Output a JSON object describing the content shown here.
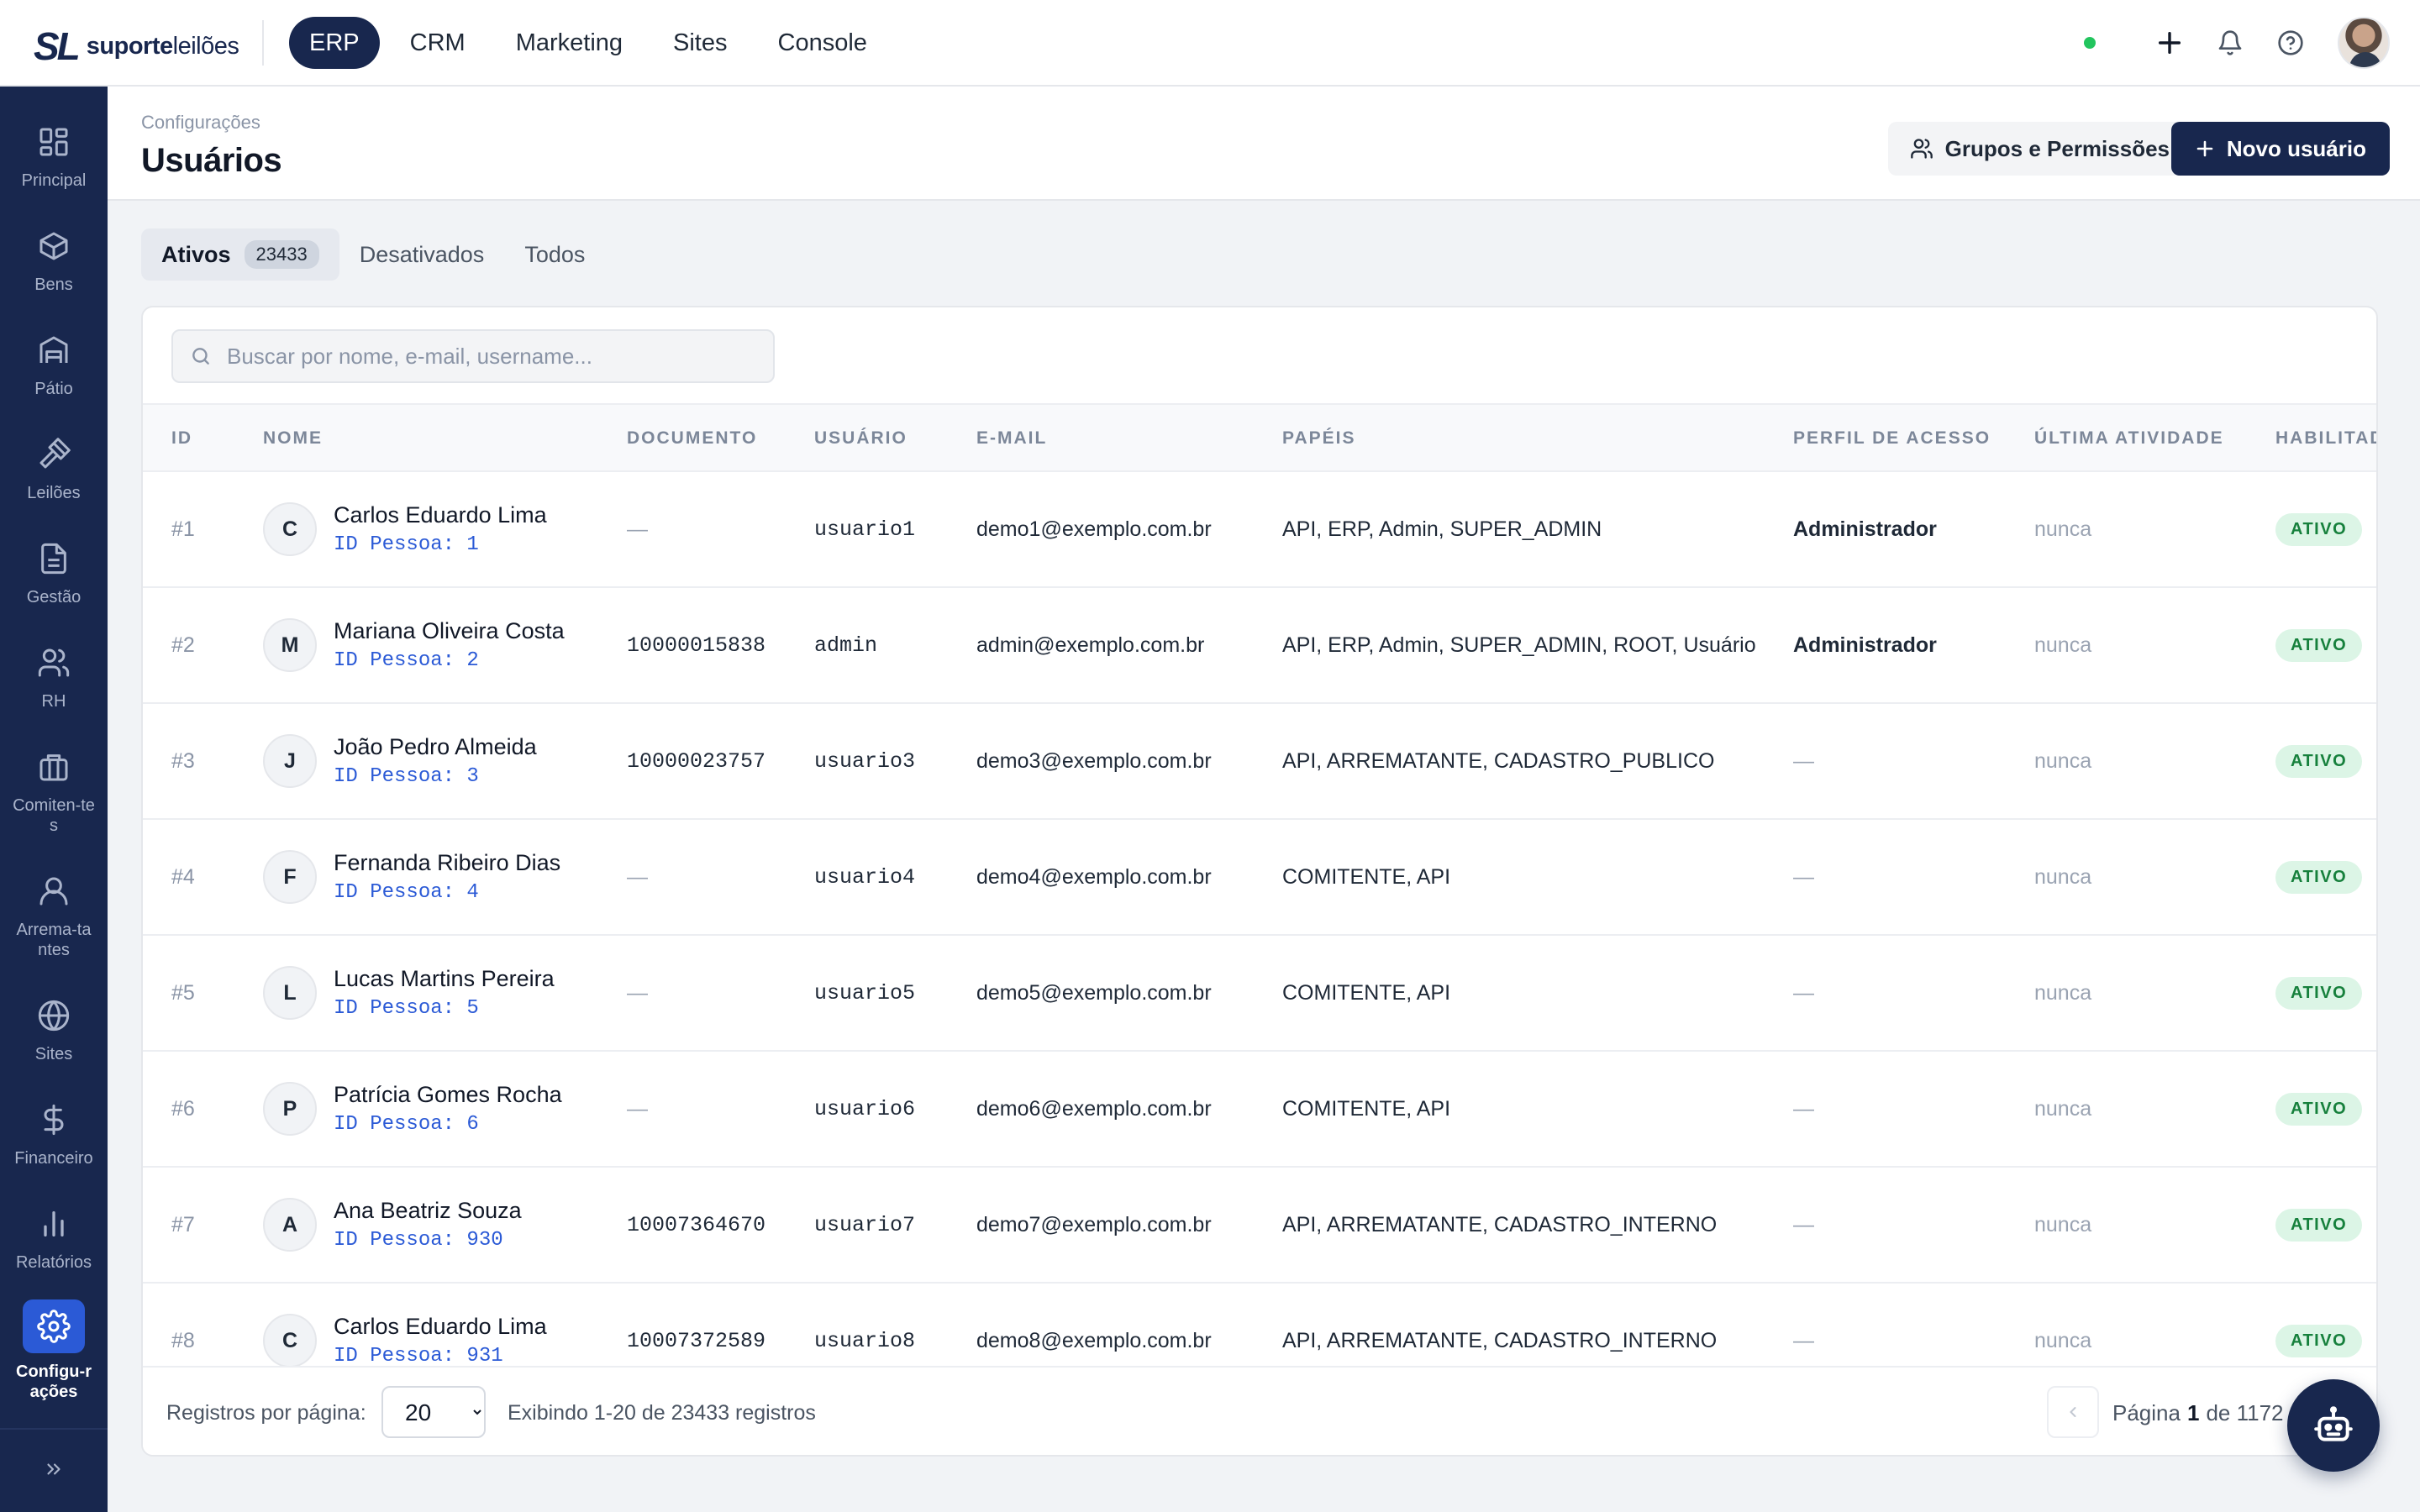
{
  "brand": {
    "mark": "SL",
    "name_bold": "suporte",
    "name_light": "leilões"
  },
  "topnav": [
    "ERP",
    "CRM",
    "Marketing",
    "Sites",
    "Console"
  ],
  "sidebar": {
    "items": [
      {
        "label": "Principal",
        "icon": "grid-icon"
      },
      {
        "label": "Bens",
        "icon": "box-icon"
      },
      {
        "label": "Pátio",
        "icon": "warehouse-icon"
      },
      {
        "label": "Leilões",
        "icon": "gavel-icon"
      },
      {
        "label": "Gestão",
        "icon": "document-icon"
      },
      {
        "label": "RH",
        "icon": "users-icon"
      },
      {
        "label": "Comiten-tes",
        "icon": "briefcase-icon"
      },
      {
        "label": "Arrema-tantes",
        "icon": "user-icon"
      },
      {
        "label": "Sites",
        "icon": "globe-icon"
      },
      {
        "label": "Financeiro",
        "icon": "dollar-icon"
      },
      {
        "label": "Relatórios",
        "icon": "bar-chart-icon"
      },
      {
        "label": "Configu-rações",
        "icon": "gear-icon"
      }
    ]
  },
  "header": {
    "breadcrumb": "Configurações",
    "title": "Usuários",
    "groups_button": "Grupos e Permissões",
    "new_button": "Novo usuário"
  },
  "tabs": {
    "active": "Ativos",
    "active_count": "23433",
    "disabled": "Desativados",
    "all": "Todos"
  },
  "search": {
    "placeholder": "Buscar por nome, e-mail, username..."
  },
  "table": {
    "columns": [
      "ID",
      "NOME",
      "DOCUMENTO",
      "USUÁRIO",
      "E-MAIL",
      "PAPÉIS",
      "PERFIL DE ACESSO",
      "ÚLTIMA ATIVIDADE",
      "HABILITAD"
    ],
    "rows": [
      {
        "id": "#1",
        "initial": "C",
        "name": "Carlos Eduardo Lima",
        "person": "ID Pessoa: 1",
        "document": "—",
        "username": "usuario1",
        "email": "demo1@exemplo.com.br",
        "roles": "API, ERP, Admin, SUPER_ADMIN",
        "profile": "Administrador",
        "last": "nunca",
        "status": "ATIVO"
      },
      {
        "id": "#2",
        "initial": "M",
        "name": "Mariana Oliveira Costa",
        "person": "ID Pessoa: 2",
        "document": "10000015838",
        "username": "admin",
        "email": "admin@exemplo.com.br",
        "roles": "API, ERP, Admin, SUPER_ADMIN, ROOT, Usuário",
        "profile": "Administrador",
        "last": "nunca",
        "status": "ATIVO"
      },
      {
        "id": "#3",
        "initial": "J",
        "name": "João Pedro Almeida",
        "person": "ID Pessoa: 3",
        "document": "10000023757",
        "username": "usuario3",
        "email": "demo3@exemplo.com.br",
        "roles": "API, ARREMATANTE, CADASTRO_PUBLICO",
        "profile": "—",
        "last": "nunca",
        "status": "ATIVO"
      },
      {
        "id": "#4",
        "initial": "F",
        "name": "Fernanda Ribeiro Dias",
        "person": "ID Pessoa: 4",
        "document": "—",
        "username": "usuario4",
        "email": "demo4@exemplo.com.br",
        "roles": "COMITENTE, API",
        "profile": "—",
        "last": "nunca",
        "status": "ATIVO"
      },
      {
        "id": "#5",
        "initial": "L",
        "name": "Lucas Martins Pereira",
        "person": "ID Pessoa: 5",
        "document": "—",
        "username": "usuario5",
        "email": "demo5@exemplo.com.br",
        "roles": "COMITENTE, API",
        "profile": "—",
        "last": "nunca",
        "status": "ATIVO"
      },
      {
        "id": "#6",
        "initial": "P",
        "name": "Patrícia Gomes Rocha",
        "person": "ID Pessoa: 6",
        "document": "—",
        "username": "usuario6",
        "email": "demo6@exemplo.com.br",
        "roles": "COMITENTE, API",
        "profile": "—",
        "last": "nunca",
        "status": "ATIVO"
      },
      {
        "id": "#7",
        "initial": "A",
        "name": "Ana Beatriz Souza",
        "person": "ID Pessoa: 930",
        "document": "10007364670",
        "username": "usuario7",
        "email": "demo7@exemplo.com.br",
        "roles": "API, ARREMATANTE, CADASTRO_INTERNO",
        "profile": "—",
        "last": "nunca",
        "status": "ATIVO"
      },
      {
        "id": "#8",
        "initial": "C",
        "name": "Carlos Eduardo Lima",
        "person": "ID Pessoa: 931",
        "document": "10007372589",
        "username": "usuario8",
        "email": "demo8@exemplo.com.br",
        "roles": "API, ARREMATANTE, CADASTRO_INTERNO",
        "profile": "—",
        "last": "nunca",
        "status": "ATIVO"
      }
    ]
  },
  "footer": {
    "per_page_label": "Registros por página:",
    "per_page_value": "20",
    "showing": "Exibindo 1-20 de 23433 registros",
    "page_label": "Página",
    "page_current": "1",
    "page_of": "de",
    "page_total": "1172"
  },
  "colors": {
    "navy": "#18274e",
    "accent_blue": "#2b5ad6",
    "status_green": "#22c55e",
    "badge_green": "#16803c"
  }
}
